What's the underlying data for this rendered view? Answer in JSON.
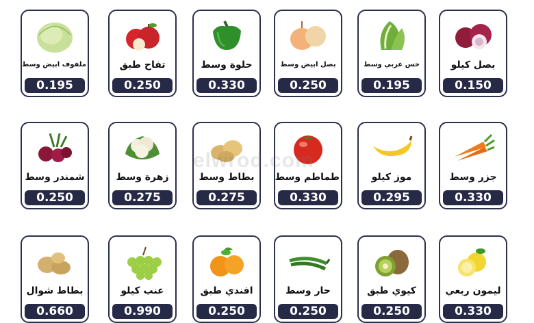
{
  "watermark": "elwrod.com",
  "rows": [
    [
      {
        "name": "ملفوف ابيض وسط",
        "price": "0.195",
        "icon": "cabbage-icon"
      },
      {
        "name": "تفاح طبق",
        "price": "0.250",
        "icon": "apple-icon"
      },
      {
        "name": "حلوة وسط",
        "price": "0.330",
        "icon": "green-pepper-icon"
      },
      {
        "name": "بصل ابيض وسط",
        "price": "0.250",
        "icon": "onion-icon"
      },
      {
        "name": "خس عربي وسط",
        "price": "0.195",
        "icon": "lettuce-icon"
      },
      {
        "name": "بصل كيلو",
        "price": "0.150",
        "icon": "red-onion-icon"
      }
    ],
    [
      {
        "name": "شمندر وسط",
        "price": "0.250",
        "icon": "beetroot-icon"
      },
      {
        "name": "زهرة وسط",
        "price": "0.275",
        "icon": "cauliflower-icon"
      },
      {
        "name": "بطاط وسط",
        "price": "0.275",
        "icon": "potato-icon"
      },
      {
        "name": "طماطم وسط",
        "price": "0.330",
        "icon": "tomato-icon"
      },
      {
        "name": "موز كيلو",
        "price": "0.295",
        "icon": "banana-icon"
      },
      {
        "name": "جزر وسط",
        "price": "0.330",
        "icon": "carrot-icon"
      }
    ],
    [
      {
        "name": "بطاط شوال",
        "price": "0.660",
        "icon": "potato-sack-icon"
      },
      {
        "name": "عنب كيلو",
        "price": "0.990",
        "icon": "grapes-icon"
      },
      {
        "name": "افندي طبق",
        "price": "0.250",
        "icon": "mandarin-icon"
      },
      {
        "name": "حار وسط",
        "price": "0.250",
        "icon": "chili-icon"
      },
      {
        "name": "كيوي طبق",
        "price": "0.250",
        "icon": "kiwi-icon"
      },
      {
        "name": "ليمون ربعي",
        "price": "0.330",
        "icon": "lemon-icon"
      }
    ]
  ]
}
